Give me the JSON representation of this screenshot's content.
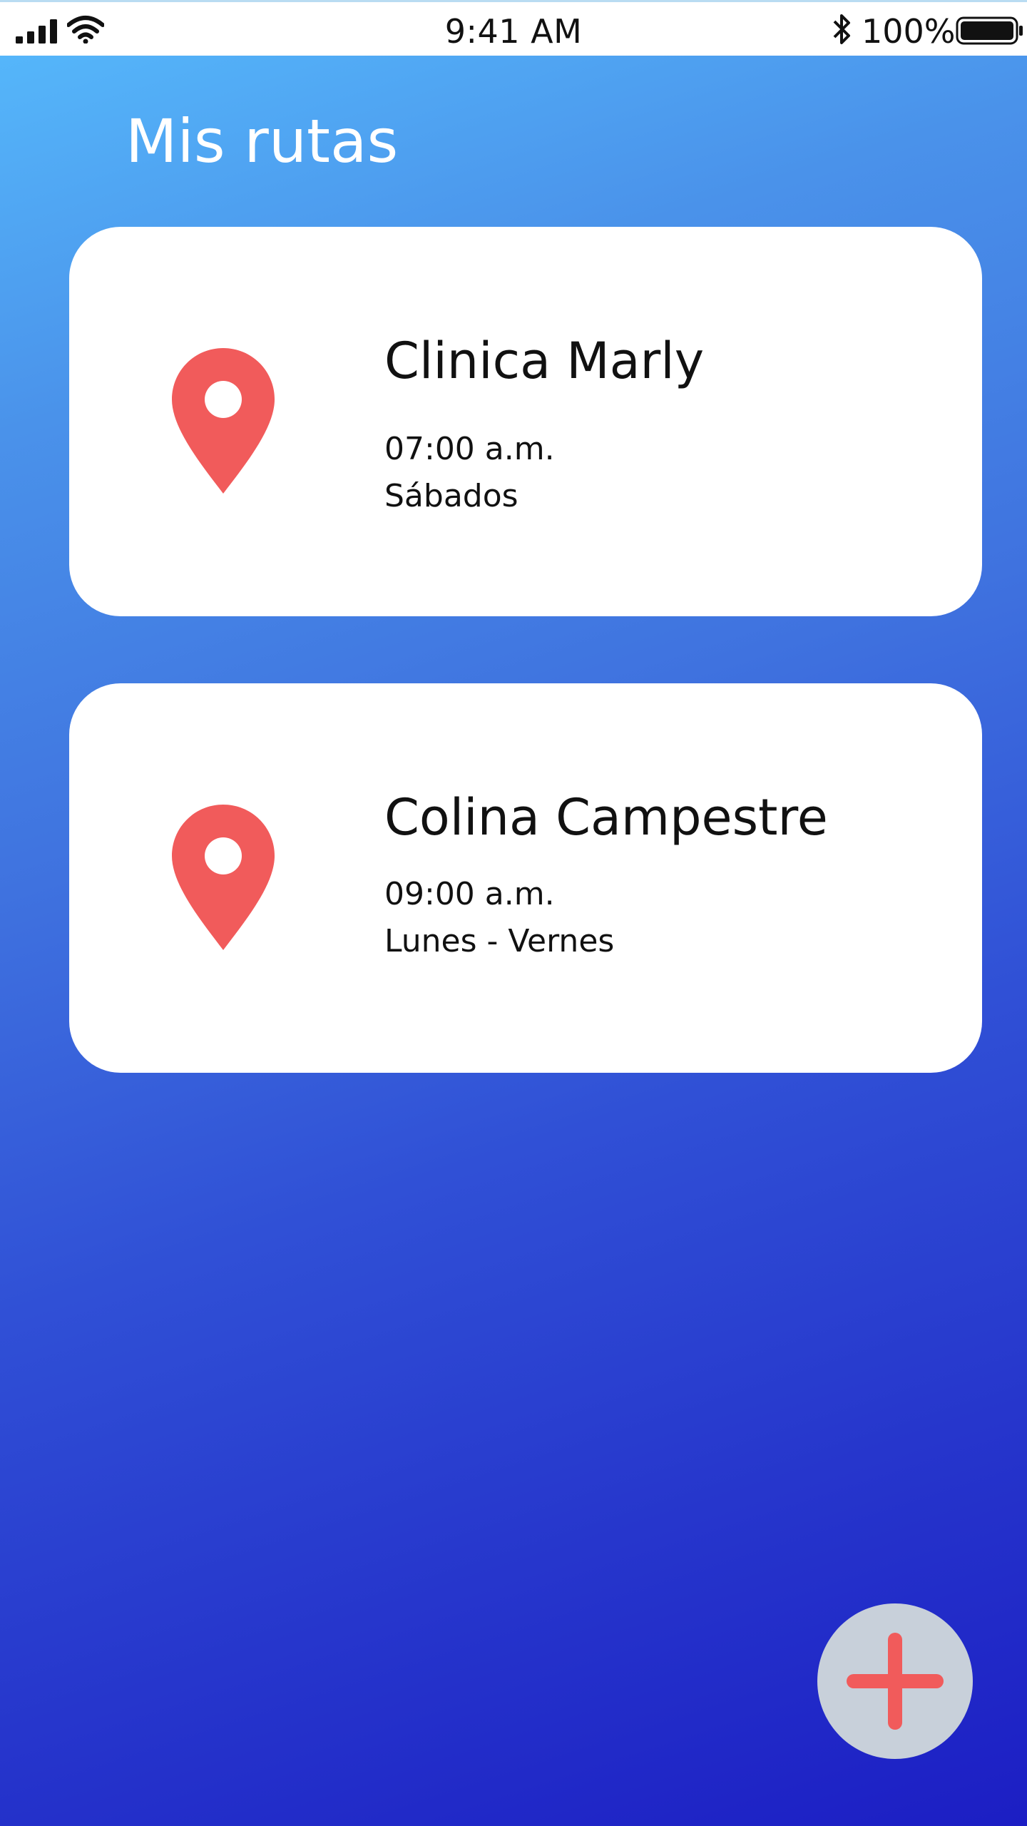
{
  "status_bar": {
    "time": "9:41 AM",
    "battery_percent": "100%",
    "battery_level": 1.0,
    "signal_icon": "cellular-signal-icon",
    "wifi_icon": "wifi-icon",
    "bluetooth_icon": "bluetooth-icon",
    "battery_icon": "battery-icon"
  },
  "header": {
    "title": "Mis rutas"
  },
  "routes": [
    {
      "name": "Clinica Marly",
      "time": "07:00 a.m.",
      "days": "Sábados",
      "icon": "location-pin-icon"
    },
    {
      "name": "Colina Campestre",
      "time": "09:00 a.m.",
      "days": "Lunes - Vernes",
      "icon": "location-pin-icon"
    }
  ],
  "fab": {
    "icon": "plus-icon"
  },
  "colors": {
    "gradient_start": "#55b6fa",
    "gradient_end": "#1c1ec4",
    "card_background": "#ffffff",
    "accent_red": "#f15b5b",
    "fab_background": "#c8d0da",
    "text_dark": "#111111",
    "title_text": "#ffffff"
  }
}
